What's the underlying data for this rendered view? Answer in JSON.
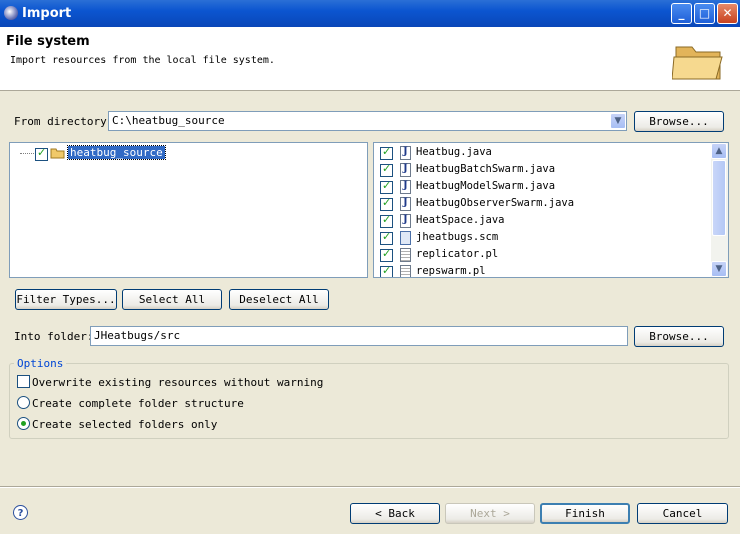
{
  "window": {
    "title": "Import"
  },
  "header": {
    "title": "File system",
    "description": "Import resources from the local file system."
  },
  "from_directory": {
    "label": "From directory:",
    "value": "C:\\heatbug_source",
    "browse_label": "Browse..."
  },
  "folder_tree": {
    "items": [
      {
        "label": "heatbug_source",
        "checked": true
      }
    ]
  },
  "file_list": {
    "items": [
      {
        "name": "Heatbug.java",
        "checked": true,
        "icon": "java-file-icon"
      },
      {
        "name": "HeatbugBatchSwarm.java",
        "checked": true,
        "icon": "java-file-icon"
      },
      {
        "name": "HeatbugModelSwarm.java",
        "checked": true,
        "icon": "java-file-icon"
      },
      {
        "name": "HeatbugObserverSwarm.java",
        "checked": true,
        "icon": "java-file-icon"
      },
      {
        "name": "HeatSpace.java",
        "checked": true,
        "icon": "java-file-icon"
      },
      {
        "name": "jheatbugs.scm",
        "checked": true,
        "icon": "scm-file-icon"
      },
      {
        "name": "replicator.pl",
        "checked": true,
        "icon": "text-file-icon"
      },
      {
        "name": "repswarm.pl",
        "checked": true,
        "icon": "text-file-icon"
      }
    ]
  },
  "selection_buttons": {
    "filter_types": "Filter Types...",
    "select_all": "Select All",
    "deselect_all": "Deselect All"
  },
  "into_folder": {
    "label": "Into folder:",
    "value": "JHeatbugs/src",
    "browse_label": "Browse..."
  },
  "options": {
    "legend": "Options",
    "overwrite": {
      "label": "Overwrite existing resources without warning",
      "checked": false
    },
    "create_complete": {
      "label": "Create complete folder structure",
      "selected": false
    },
    "create_selected": {
      "label": "Create selected folders only",
      "selected": true
    }
  },
  "footer": {
    "back": "< Back",
    "next": "Next >",
    "finish": "Finish",
    "cancel": "Cancel"
  },
  "colors": {
    "titlebar": "#0b55d0",
    "selection": "#316ac5",
    "dialog_bg": "#ece9d8"
  }
}
